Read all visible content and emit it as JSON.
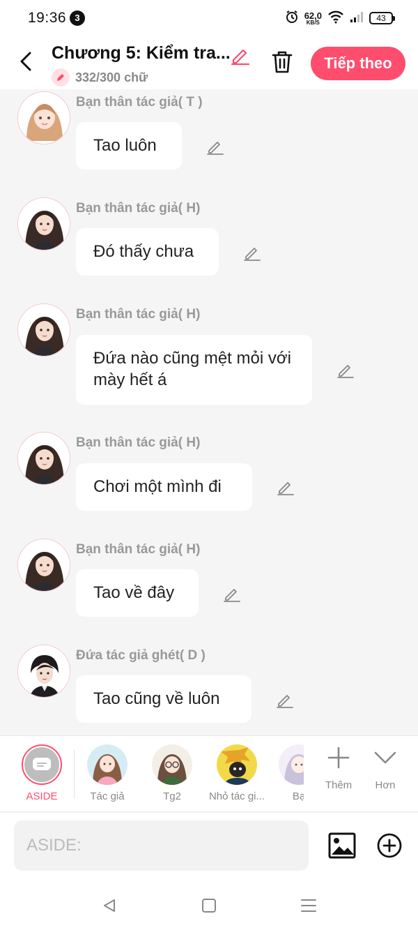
{
  "status_bar": {
    "time": "19:36",
    "notification_count": "3",
    "net_speed": "62,0",
    "net_unit": "KB/S",
    "battery": "43"
  },
  "header": {
    "title": "Chương 5: Kiểm tra...",
    "word_count": "332/300 chữ",
    "next_label": "Tiếp theo",
    "accent_color": "#ff4d6d"
  },
  "messages": [
    {
      "speaker": "Bạn thân tác giả( T )",
      "text": "Tao luôn",
      "avatar": "girl-light-hair"
    },
    {
      "speaker": "Bạn thân tác giả( H)",
      "text": "Đó thấy chưa",
      "avatar": "girl-dark-hair"
    },
    {
      "speaker": "Bạn thân tác giả( H)",
      "text": "Đứa nào cũng mệt mỏi với mày hết á",
      "avatar": "girl-dark-hair"
    },
    {
      "speaker": "Bạn thân tác giả( H)",
      "text": "Chơi một mình đi",
      "avatar": "girl-dark-hair"
    },
    {
      "speaker": "Bạn thân tác giả( H)",
      "text": "Tao về đây",
      "avatar": "girl-dark-hair"
    },
    {
      "speaker": "Đứa tác giả ghét( D )",
      "text": "Tao cũng về luôn",
      "avatar": "boy-dark-hair"
    }
  ],
  "characters": [
    {
      "label": "ASIDE",
      "selected": true
    },
    {
      "label": "Tác giả"
    },
    {
      "label": "Tg2"
    },
    {
      "label": "Nhỏ tác gi..."
    },
    {
      "label": "Bạ"
    }
  ],
  "tools": [
    {
      "label": "Thêm",
      "icon": "plus-icon"
    },
    {
      "label": "Hơn",
      "icon": "chevron-down-icon"
    }
  ],
  "input": {
    "placeholder": "ASIDE:"
  }
}
